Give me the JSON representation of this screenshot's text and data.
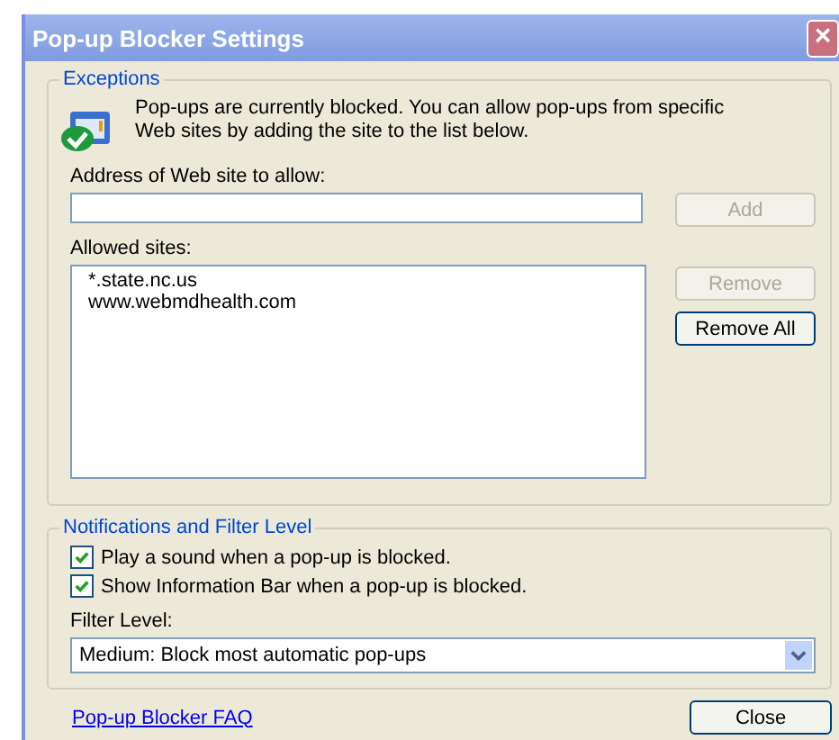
{
  "window": {
    "title": "Pop-up Blocker Settings",
    "close": "×"
  },
  "exceptions": {
    "legend": "Exceptions",
    "message": "Pop-ups are currently blocked.  You can allow pop-ups from specific Web sites by adding the site to the list below.",
    "address_label": "Address of Web site to allow:",
    "add_button": {
      "label": "Add",
      "disabled": true
    },
    "allowed_label": "Allowed sites:",
    "allowed_sites": [
      {
        "label": "*.state.nc.us",
        "selected": false
      },
      {
        "label": "www.webmdhealth.com",
        "selected": false
      }
    ],
    "remove_button": {
      "label": "Remove",
      "disabled": true
    },
    "remove_all_button": {
      "label": "Remove All",
      "disabled": false
    }
  },
  "notifications": {
    "legend": "Notifications and Filter Level",
    "options": [
      {
        "label": "Play a sound when a pop-up is blocked.",
        "checked": true
      },
      {
        "label": "Show Information Bar when a pop-up is blocked.",
        "checked": true
      }
    ],
    "filter_label": "Filter Level:",
    "filter_value": "Medium: Block most automatic pop-ups"
  },
  "faq_link": "Pop-up Blocker FAQ",
  "close_button": "Close"
}
